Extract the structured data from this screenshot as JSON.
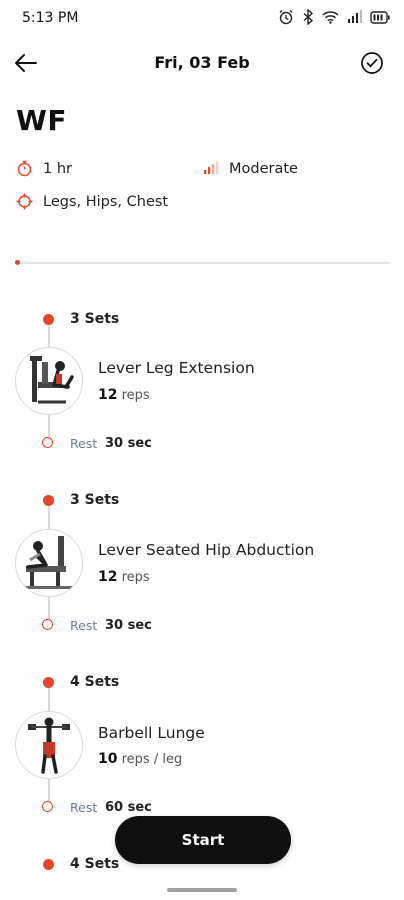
{
  "status_bar": {
    "time": "5:13 PM"
  },
  "header": {
    "date": "Fri, 03 Feb"
  },
  "workout": {
    "name": "WF",
    "duration": "1 hr",
    "level": "Moderate",
    "muscles": "Legs, Hips, Chest",
    "progress": 0
  },
  "exercises": [
    {
      "sets": "3 Sets",
      "name": "Lever Leg Extension",
      "reps_value": "12",
      "reps_unit": "reps",
      "rest_label": "Rest",
      "rest_value": "30 sec"
    },
    {
      "sets": "3 Sets",
      "name": "Lever Seated Hip Abduction",
      "reps_value": "12",
      "reps_unit": "reps",
      "rest_label": "Rest",
      "rest_value": "30 sec"
    },
    {
      "sets": "4 Sets",
      "name": "Barbell Lunge",
      "reps_value": "10",
      "reps_unit": "reps / leg",
      "rest_label": "Rest",
      "rest_value": "60 sec"
    },
    {
      "sets": "4 Sets"
    }
  ],
  "actions": {
    "start_label": "Start"
  },
  "colors": {
    "accent": "#e8432b",
    "button": "#0f0f0f"
  },
  "icons": [
    "back-arrow-icon",
    "check-circle-icon",
    "timer-icon",
    "intensity-bars-icon",
    "target-icon"
  ]
}
